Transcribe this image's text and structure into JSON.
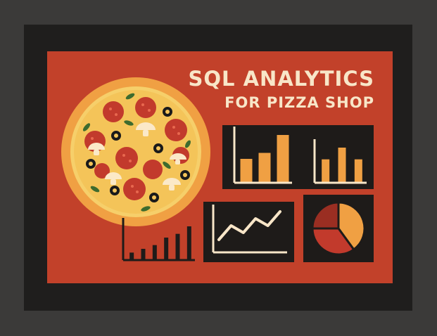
{
  "poster": {
    "title_line1": "SQL ANALYTICS",
    "title_line2": "FOR PIZZA SHOP"
  },
  "colors": {
    "background": "#3b3a39",
    "frame": "#1f1e1d",
    "poster": "#c2412a",
    "cream": "#f8e6c8",
    "orange": "#f0a043",
    "dark_panel": "#1e1b19",
    "pepperoni": "#c23a2c",
    "olive": "#1a1a1a",
    "basil": "#3d6b2e"
  },
  "icons": [
    "pizza-icon",
    "bar-chart-icon",
    "line-chart-icon",
    "pie-chart-icon"
  ],
  "charts": {
    "left_bars": {
      "values": [
        2,
        3,
        4,
        6,
        7,
        9
      ]
    },
    "panel_bars_left": {
      "values": [
        4,
        5,
        8
      ]
    },
    "panel_bars_right": {
      "values": [
        4,
        6,
        4
      ]
    },
    "line": {
      "values": [
        1,
        3,
        2,
        4,
        3,
        5
      ]
    },
    "pie": {
      "values": [
        40,
        35,
        25
      ]
    }
  }
}
